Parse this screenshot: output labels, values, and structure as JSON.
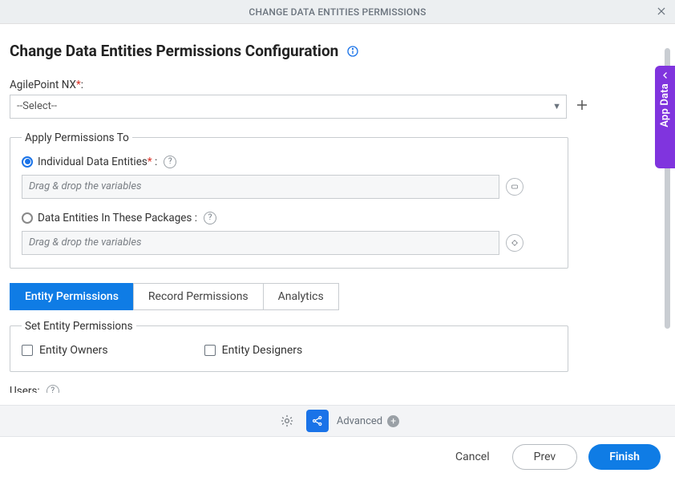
{
  "dialog": {
    "header_title": "CHANGE DATA ENTITIES PERMISSIONS",
    "page_title": "Change Data Entities Permissions Configuration"
  },
  "side_tab": {
    "label": "App Data"
  },
  "fields": {
    "agilepoint_label": "AgilePoint NX",
    "agilepoint_required": "*",
    "agilepoint_colon": ":",
    "agilepoint_selected": "--Select--"
  },
  "apply_section": {
    "legend": "Apply Permissions To",
    "individual_label": "Individual Data Entities",
    "individual_required": "*",
    "individual_suffix": " :",
    "packages_label": "Data Entities In These Packages :",
    "dropzone_placeholder": "Drag & drop the variables"
  },
  "tabs": {
    "entity": "Entity Permissions",
    "record": "Record Permissions",
    "analytics": "Analytics"
  },
  "entity_perm": {
    "legend": "Set Entity Permissions",
    "owners": "Entity Owners",
    "designers": "Entity Designers"
  },
  "users": {
    "label": "Users:"
  },
  "footer": {
    "advanced": "Advanced",
    "cancel": "Cancel",
    "prev": "Prev",
    "finish": "Finish"
  },
  "icons": {
    "close": "close",
    "info": "info",
    "help": "help",
    "add": "add",
    "chevron_left": "chevron-left",
    "entity_slot": "entity-slot",
    "package_slot": "package-slot",
    "gear": "gear",
    "share": "share"
  },
  "colors": {
    "primary_blue": "#0f7ce5",
    "link_blue": "#1a73e8",
    "purple": "#8034de"
  }
}
